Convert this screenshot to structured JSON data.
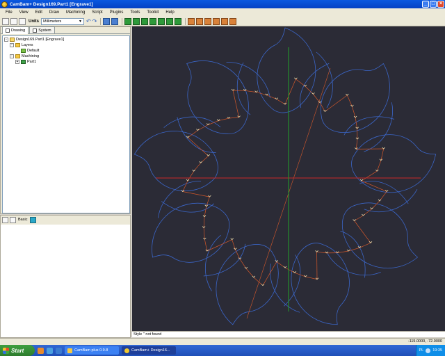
{
  "window": {
    "title": "CamBam+  Design169.Part1 [Engrave1]"
  },
  "menu": [
    "File",
    "View",
    "Edit",
    "Draw",
    "Machining",
    "Script",
    "Plugins",
    "Tools",
    "Toolkit",
    "Help"
  ],
  "toolbar": {
    "units_label": "Units",
    "units_value": "Millimeters"
  },
  "panel": {
    "tabs": [
      "Drawing",
      "System"
    ],
    "tree": [
      {
        "label": "Design169.Part1 [Engrave1]",
        "icon": "document-icon",
        "level": 0,
        "expander": "-"
      },
      {
        "label": "Layers",
        "icon": "folder-icon",
        "level": 1,
        "expander": "-"
      },
      {
        "label": "Default",
        "icon": "layer-icon",
        "level": 2,
        "expander": ""
      },
      {
        "label": "Machining",
        "icon": "folder-icon",
        "level": 1,
        "expander": "-"
      },
      {
        "label": "Part1",
        "icon": "part-icon",
        "level": 2,
        "expander": "+"
      }
    ]
  },
  "properties": {
    "mode_label": "Basic"
  },
  "message": "Style '' not found",
  "status": {
    "coords": "-115.0000, -72.0000"
  },
  "taskbar": {
    "start_label": "Start",
    "items": [
      "CamBam plus 0.9.8",
      "CamBam+  Design16..."
    ],
    "language": "PL",
    "clock": "19:35"
  },
  "colors": {
    "canvas_bg": "#2b2b36",
    "shape_outline": "#3b66c8",
    "toolpath": "#d4582a",
    "axis_x": "#c82828",
    "axis_y": "#23a02a"
  }
}
